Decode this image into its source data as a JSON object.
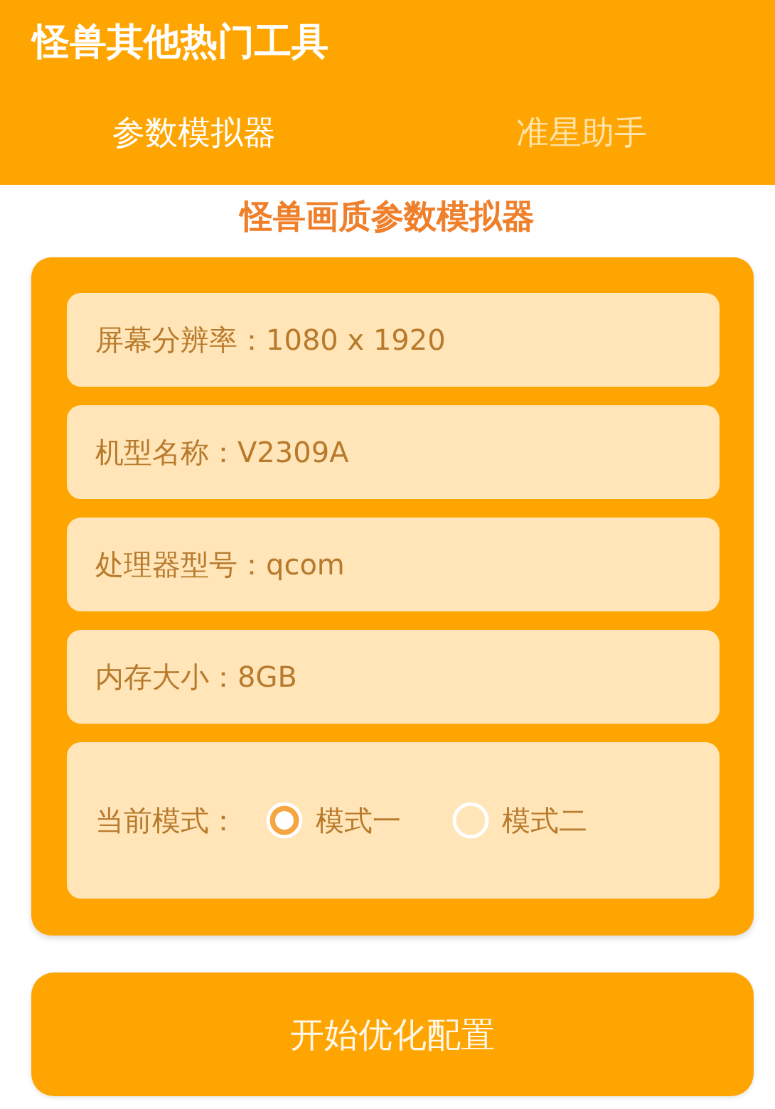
{
  "app_bar": {
    "title": "怪兽其他热门工具"
  },
  "tabs": [
    {
      "label": "参数模拟器",
      "selected": true
    },
    {
      "label": "准星助手",
      "selected": false
    }
  ],
  "heading": "怪兽画质参数模拟器",
  "info_fields": [
    {
      "label": "屏幕分辨率：",
      "value": "1080 x 1920"
    },
    {
      "label": "机型名称：",
      "value": "V2309A"
    },
    {
      "label": "处理器型号：",
      "value": "qcom"
    },
    {
      "label": "内存大小：",
      "value": "8GB"
    }
  ],
  "mode": {
    "label": "当前模式：",
    "options": [
      {
        "label": "模式一",
        "selected": true
      },
      {
        "label": "模式二",
        "selected": false
      }
    ]
  },
  "action_button": "开始优化配置"
}
